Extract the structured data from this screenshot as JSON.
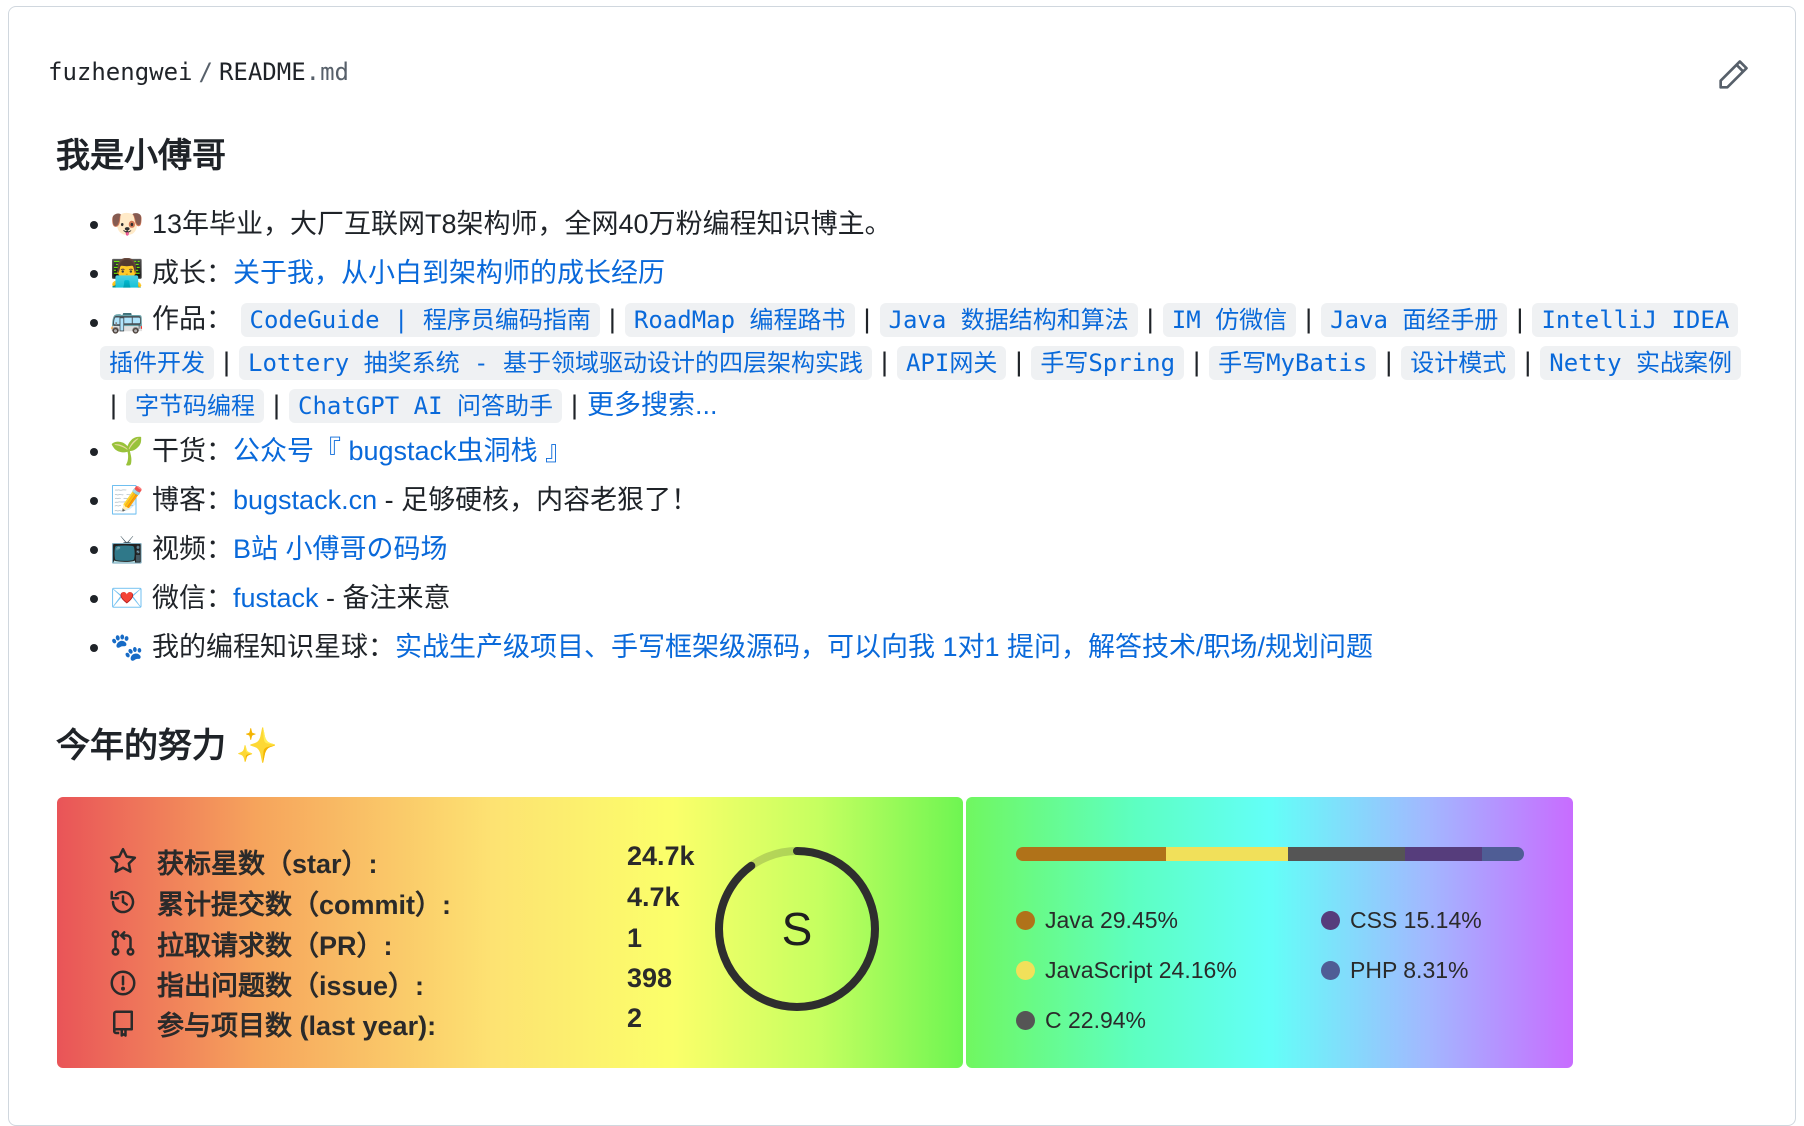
{
  "header": {
    "owner": "fuzhengwei",
    "separator": "/",
    "file_base": "README",
    "file_ext": ".md",
    "edit_icon": "pencil-icon"
  },
  "about": {
    "title": "我是小傅哥",
    "items": [
      {
        "emoji": "🐶",
        "text": "13年毕业，大厂互联网T8架构师，全网40万粉编程知识博主。"
      },
      {
        "emoji": "👨‍💻",
        "label": "成长：",
        "link": "关于我，从小白到架构师的成长经历"
      },
      {
        "emoji": "🚌",
        "label": "作品："
      },
      {
        "emoji": "🌱",
        "label": "干货：",
        "link": "公众号『 bugstack虫洞栈 』"
      },
      {
        "emoji": "📝",
        "label": "博客：",
        "link": "bugstack.cn",
        "suffix": " - 足够硬核，内容老狠了！"
      },
      {
        "emoji": "📺",
        "label": "视频：",
        "link": "B站 小傅哥の码场"
      },
      {
        "emoji": "💌",
        "label": "微信：",
        "link": "fustack",
        "suffix": " - 备注来意"
      },
      {
        "emoji": "🐾",
        "label": "我的编程知识星球：",
        "link": "实战生产级项目、手写框架级源码，可以向我 1对1 提问，解答技术/职场/规划问题"
      }
    ],
    "works": [
      "CodeGuide | 程序员编码指南",
      "RoadMap 编程路书",
      "Java 数据结构和算法",
      "IM 仿微信",
      "Java 面经手册",
      "IntelliJ IDEA",
      "插件开发",
      "Lottery 抽奖系统 - 基于领域驱动设计的四层架构实践",
      "API网关",
      "手写Spring",
      "手写MyBatis",
      "设计模式",
      "Netty 实战案例",
      "字节码编程",
      "ChatGPT AI 问答助手"
    ],
    "works_separator": "|",
    "works_more": "更多搜索..."
  },
  "effort": {
    "title": "今年的努力 ✨",
    "stats": [
      {
        "icon": "star-icon",
        "label": "获标星数（star）:",
        "value": "24.7k"
      },
      {
        "icon": "history-icon",
        "label": "累计提交数（commit）:",
        "value": "4.7k"
      },
      {
        "icon": "pull-request-icon",
        "label": "拉取请求数（PR）:",
        "value": "1"
      },
      {
        "icon": "issue-icon",
        "label": "指出问题数（issue）:",
        "value": "398"
      },
      {
        "icon": "repo-icon",
        "label": "参与项目数 (last year):",
        "value": "2"
      }
    ],
    "rank": "S",
    "rank_progress": 0.9,
    "languages": [
      {
        "name": "Java 29.45%",
        "color": "#b07219",
        "percent": 29.45
      },
      {
        "name": "JavaScript 24.16%",
        "color": "#f1e05a",
        "percent": 24.16
      },
      {
        "name": "C 22.94%",
        "color": "#555555",
        "percent": 22.94
      },
      {
        "name": "CSS 15.14%",
        "color": "#563d7c",
        "percent": 15.14
      },
      {
        "name": "PHP 8.31%",
        "color": "#4f5d95",
        "percent": 8.31
      }
    ]
  }
}
